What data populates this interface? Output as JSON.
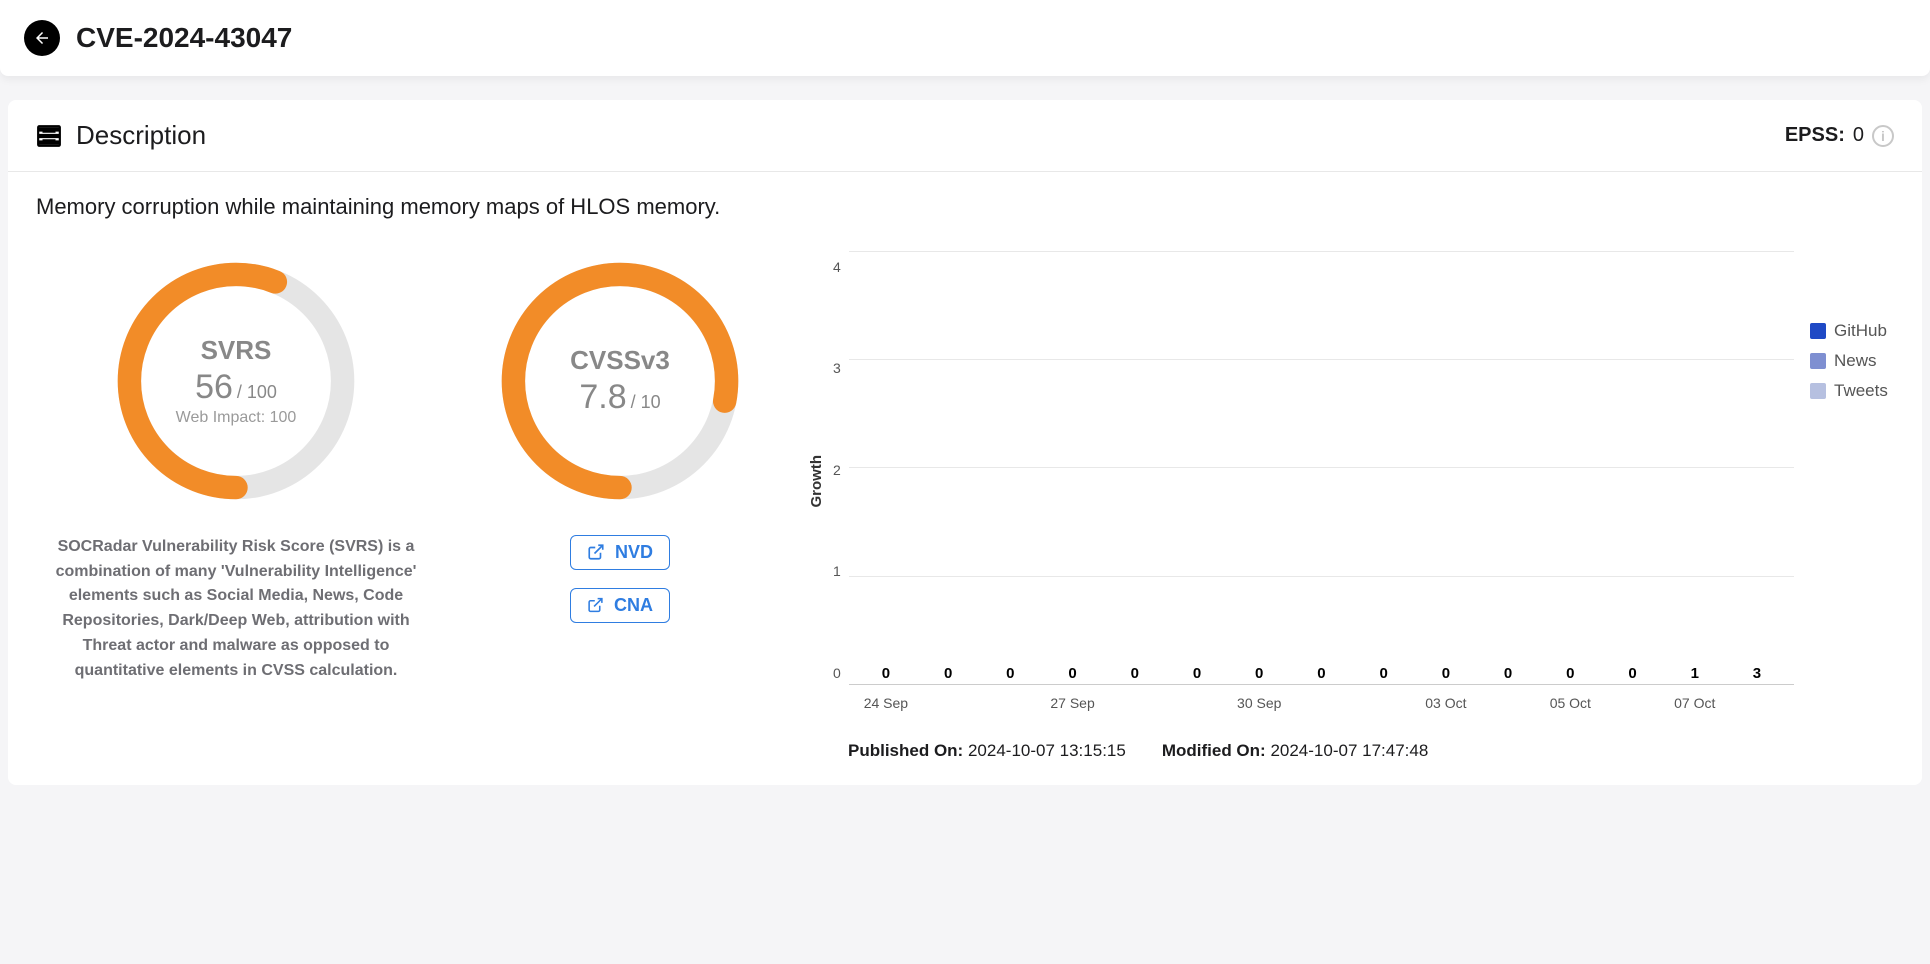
{
  "header": {
    "title": "CVE-2024-43047"
  },
  "section": {
    "title": "Description",
    "epss_label": "EPSS:",
    "epss_value": "0"
  },
  "description": "Memory corruption while maintaining memory maps of HLOS memory.",
  "svrs": {
    "title": "SVRS",
    "value": "56",
    "max": "/ 100",
    "sub_label": "Web Impact: 100",
    "percent": 56,
    "caption": "SOCRadar Vulnerability Risk Score (SVRS) is a combination of many 'Vulnerability Intelligence' elements such as Social Media, News, Code Repositories, Dark/Deep Web, attribution with Threat actor and malware as opposed to quantitative elements in CVSS calculation."
  },
  "cvss": {
    "title": "CVSSv3",
    "value": "7.8",
    "max": "/ 10",
    "percent": 78,
    "links": {
      "nvd": "NVD",
      "cna": "CNA"
    }
  },
  "chart_data": {
    "type": "bar",
    "ylabel": "Growth",
    "ylim": [
      0,
      4
    ],
    "yticks": [
      0,
      1,
      2,
      3,
      4
    ],
    "categories": [
      "24 Sep",
      "",
      "",
      "27 Sep",
      "",
      "",
      "30 Sep",
      "",
      "",
      "03 Oct",
      "",
      "05 Oct",
      "",
      "07 Oct",
      ""
    ],
    "values": [
      0,
      0,
      0,
      0,
      0,
      0,
      0,
      0,
      0,
      0,
      0,
      0,
      0,
      1,
      3
    ],
    "legend": [
      {
        "name": "GitHub",
        "color": "#1f49c5"
      },
      {
        "name": "News",
        "color": "#7e8fd1"
      },
      {
        "name": "Tweets",
        "color": "#b6c0e0"
      }
    ]
  },
  "timestamps": {
    "published_label": "Published On:",
    "published_value": "2024-10-07 13:15:15",
    "modified_label": "Modified On:",
    "modified_value": "2024-10-07 17:47:48"
  }
}
